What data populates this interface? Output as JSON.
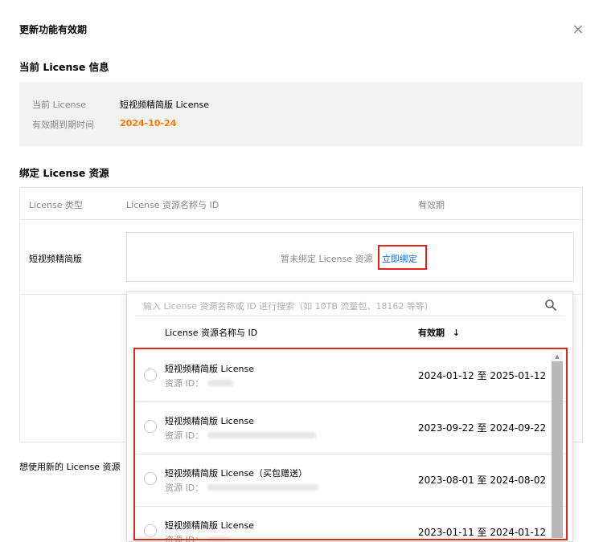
{
  "dialog": {
    "title": "更新功能有效期",
    "close_icon": "×"
  },
  "current_license": {
    "section_title": "当前 License 信息",
    "license_label": "当前 License",
    "license_value": "短视频精简版 License",
    "expiry_label": "有效期到期时间",
    "expiry_value": "2024-10-24"
  },
  "bind_section": {
    "section_title": "绑定 License 资源",
    "columns": [
      "License 类型",
      "License 资源名称与 ID",
      "有效期"
    ],
    "row_type": "短视频精简版",
    "unbound_hint": "暂未绑定 License 资源",
    "bind_link": "立即绑定"
  },
  "footer": {
    "text": "想使用新的 License 资源"
  },
  "dropdown": {
    "search_placeholder": "输入 License 资源名称或 ID 进行搜索（如 10TB 流量包、18162 等等）",
    "col_name": "License 资源名称与 ID",
    "col_period": "有效期",
    "sort_icon": "↓",
    "id_label": "资源 ID：",
    "items": [
      {
        "name": "短视频精简版 License",
        "period": "2024-01-12 至 2025-01-12"
      },
      {
        "name": "短视频精简版 License",
        "period": "2023-09-22 至 2024-09-22"
      },
      {
        "name": "短视频精简版 License（买包赠送）",
        "period": "2023-08-01 至 2024-08-02"
      },
      {
        "name": "短视频精简版 License",
        "period": "2023-01-11 至 2024-01-12"
      }
    ]
  },
  "colors": {
    "accent_link": "#006eff",
    "date_orange": "#ff7800",
    "highlight_red": "#e1251b"
  }
}
